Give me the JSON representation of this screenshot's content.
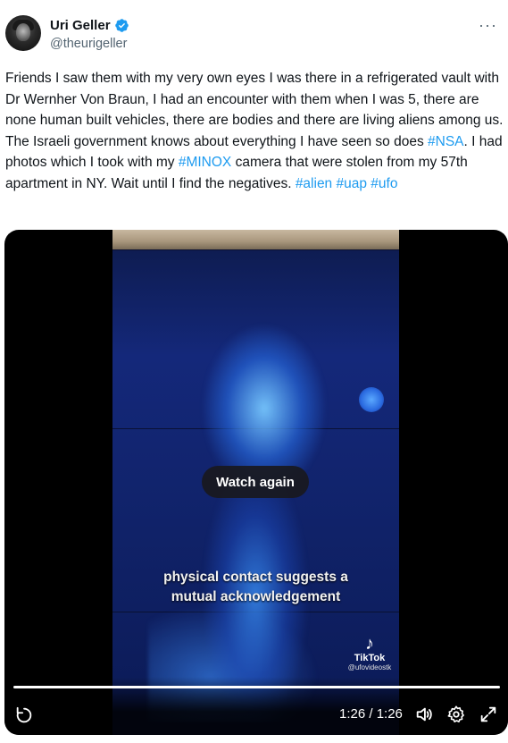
{
  "author": {
    "name": "Uri Geller",
    "handle": "@theurigeller",
    "verified": true
  },
  "tweet": {
    "text_part1": "Friends I saw them with my very own eyes I was there in a refrigerated vault with Dr Wernher Von Braun, I had an encounter with them when I was 5, there are none human built vehicles, there are bodies and there are living aliens among us. The Israeli government knows about everything I have seen so does ",
    "tag_nsa": "#NSA",
    "text_part2": ". I had  photos which I took with my ",
    "tag_minox": "#MINOX",
    "text_part3": " camera that were stolen from my 57th apartment in NY. Wait until I find the negatives. ",
    "tag_alien": "#alien",
    "tag_uap": "#uap",
    "tag_ufo": "#ufo"
  },
  "video": {
    "caption_line1": "physical contact suggests a",
    "caption_line2": "mutual acknowledgement",
    "watermark_brand": "TikTok",
    "watermark_user": "@ufovideostk",
    "watch_again_label": "Watch again",
    "time_display": "1:26 / 1:26",
    "progress": 1.0
  },
  "icons": {
    "more": "more-icon",
    "verified": "verified-badge-icon",
    "replay": "replay-icon",
    "volume": "volume-icon",
    "settings": "gear-icon",
    "fullscreen": "fullscreen-icon"
  },
  "colors": {
    "link": "#1d9bf0",
    "verified": "#1d9bf0",
    "text": "#0f1419",
    "secondary": "#536471"
  }
}
